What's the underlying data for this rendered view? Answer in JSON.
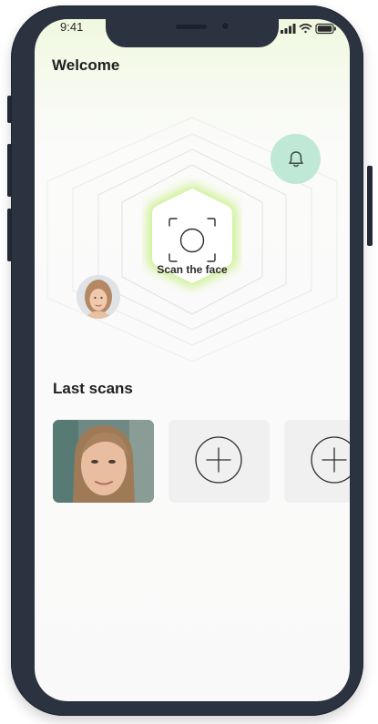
{
  "status_bar": {
    "time": "9:41"
  },
  "header": {
    "title": "Welcome"
  },
  "scan": {
    "label": "Scan the face",
    "icon": "face-scan-icon"
  },
  "notifications": {
    "icon": "bell-icon"
  },
  "last_scans": {
    "title": "Last scans",
    "items": [
      {
        "type": "photo"
      },
      {
        "type": "add",
        "icon": "plus-circle-icon"
      },
      {
        "type": "add",
        "icon": "plus-circle-icon"
      }
    ]
  },
  "colors": {
    "accent_green": "#c9ef86",
    "bell_background": "#bfe9d6",
    "frame": "#2b3240",
    "tile": "#f0f0f0"
  }
}
